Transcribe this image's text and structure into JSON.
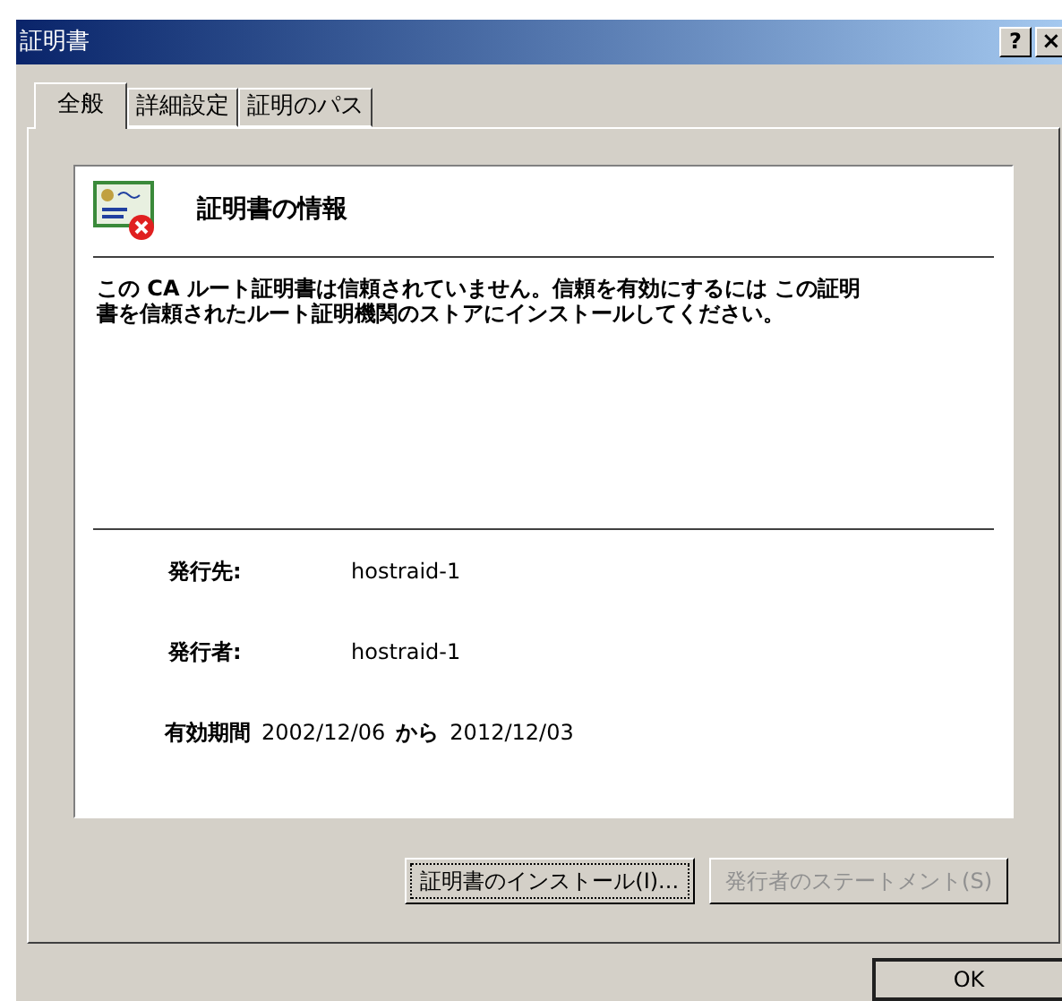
{
  "window": {
    "title": "証明書",
    "help_button": "?",
    "close_button": "×"
  },
  "tabs": [
    {
      "label": "全般",
      "selected": true
    },
    {
      "label": "詳細設定",
      "selected": false
    },
    {
      "label": "証明のパス",
      "selected": false
    }
  ],
  "info": {
    "heading": "証明書の情報",
    "message": "この CA ルート証明書は信頼されていません。信頼を有効にするには この証明書を信頼されたルート証明機関のストアにインストールしてください。",
    "fields": [
      {
        "label": "発行先:",
        "value": "hostraid-1"
      },
      {
        "label": "発行者:",
        "value": "hostraid-1"
      }
    ],
    "validity": {
      "label": "有効期間",
      "from": "2002/12/06",
      "sep": "から",
      "to": "2012/12/03"
    }
  },
  "buttons": [
    {
      "label": "証明書のインストール(I)...",
      "disabled": false
    },
    {
      "label": "発行者のステートメント(S)",
      "disabled": true
    }
  ],
  "ok_button": "OK"
}
